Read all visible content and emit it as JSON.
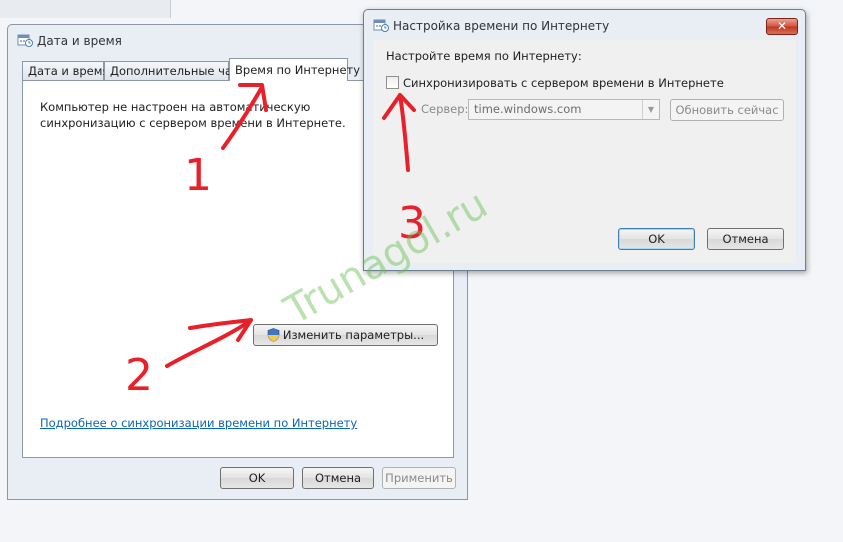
{
  "main_dialog": {
    "title": "Дата и время",
    "tabs": [
      {
        "label": "Дата и время"
      },
      {
        "label": "Дополнительные часы"
      },
      {
        "label": "Время по Интернету"
      }
    ],
    "status_text": "Компьютер не настроен на автоматическую синхронизацию с сервером времени в Интернете.",
    "change_settings_label": "Изменить параметры...",
    "link_text": "Подробнее о синхронизации времени по Интернету",
    "ok_label": "OK",
    "cancel_label": "Отмена",
    "apply_label": "Применить"
  },
  "internet_time_dialog": {
    "title": "Настройка времени по Интернету",
    "close_label": "✕",
    "heading": "Настройте время по Интернету:",
    "sync_label": "Синхронизировать с сервером времени в Интернете",
    "sync_checked": false,
    "server_label": "Сервер:",
    "server_value": "time.windows.com",
    "update_now_label": "Обновить сейчас",
    "ok_label": "OK",
    "cancel_label": "Отмена"
  },
  "annotations": {
    "markers": [
      "1",
      "2",
      "3"
    ],
    "marker_color": "#e8202a",
    "watermark": "Trunagol.ru",
    "watermark_color": "#64be50"
  }
}
